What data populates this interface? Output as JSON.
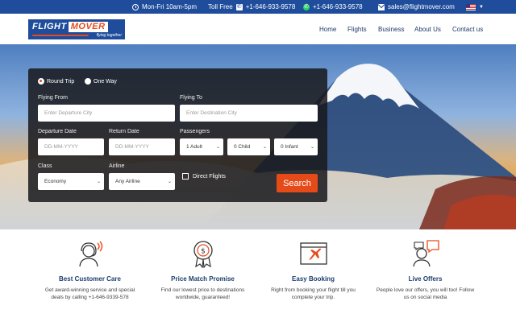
{
  "topbar": {
    "hours": "Mon-Fri 10am-5pm",
    "tollfree_label": "Toll Free",
    "tollfree_number": "+1-646-933-9578",
    "whatsapp_number": "+1-646-933-9578",
    "email": "sales@flightmover.com"
  },
  "logo": {
    "word1": "FLIGHT",
    "word2": "MOVER",
    "tagline": "flying together"
  },
  "nav": {
    "items": [
      "Home",
      "Flights",
      "Business",
      "About Us",
      "Contact us"
    ]
  },
  "search": {
    "trip_types": [
      "Round Trip",
      "One Way"
    ],
    "from_label": "Flying From",
    "from_placeholder": "Enter Departure City",
    "to_label": "Flying To",
    "to_placeholder": "Enter Destination City",
    "departure_label": "Departure Date",
    "departure_placeholder": "DD-MM-YYYY",
    "return_label": "Return Date",
    "return_placeholder": "DD-MM-YYYY",
    "passengers_label": "Passengers",
    "adult_value": "1 Adult",
    "child_value": "0 Child",
    "infant_value": "0 Infant",
    "class_label": "Class",
    "class_value": "Economy",
    "airline_label": "Airline",
    "airline_value": "Any Airline",
    "direct_label": "Direct Flights",
    "search_label": "Search"
  },
  "features": [
    {
      "title": "Best Customer Care",
      "desc": "Get award-winning service and special deals by calling +1-646-9339-578"
    },
    {
      "title": "Price Match Promise",
      "desc": "Find our lowest price to destinations worldwide, guaranteed!"
    },
    {
      "title": "Easy Booking",
      "desc": "Right from booking your flight till you complete your trip."
    },
    {
      "title": "Live Offers",
      "desc": "People love our offers, you will too! Follow us on social media"
    }
  ],
  "colors": {
    "brand_blue": "#1f4d9b",
    "accent_orange": "#e64a19",
    "heading_navy": "#1d3f6e"
  }
}
